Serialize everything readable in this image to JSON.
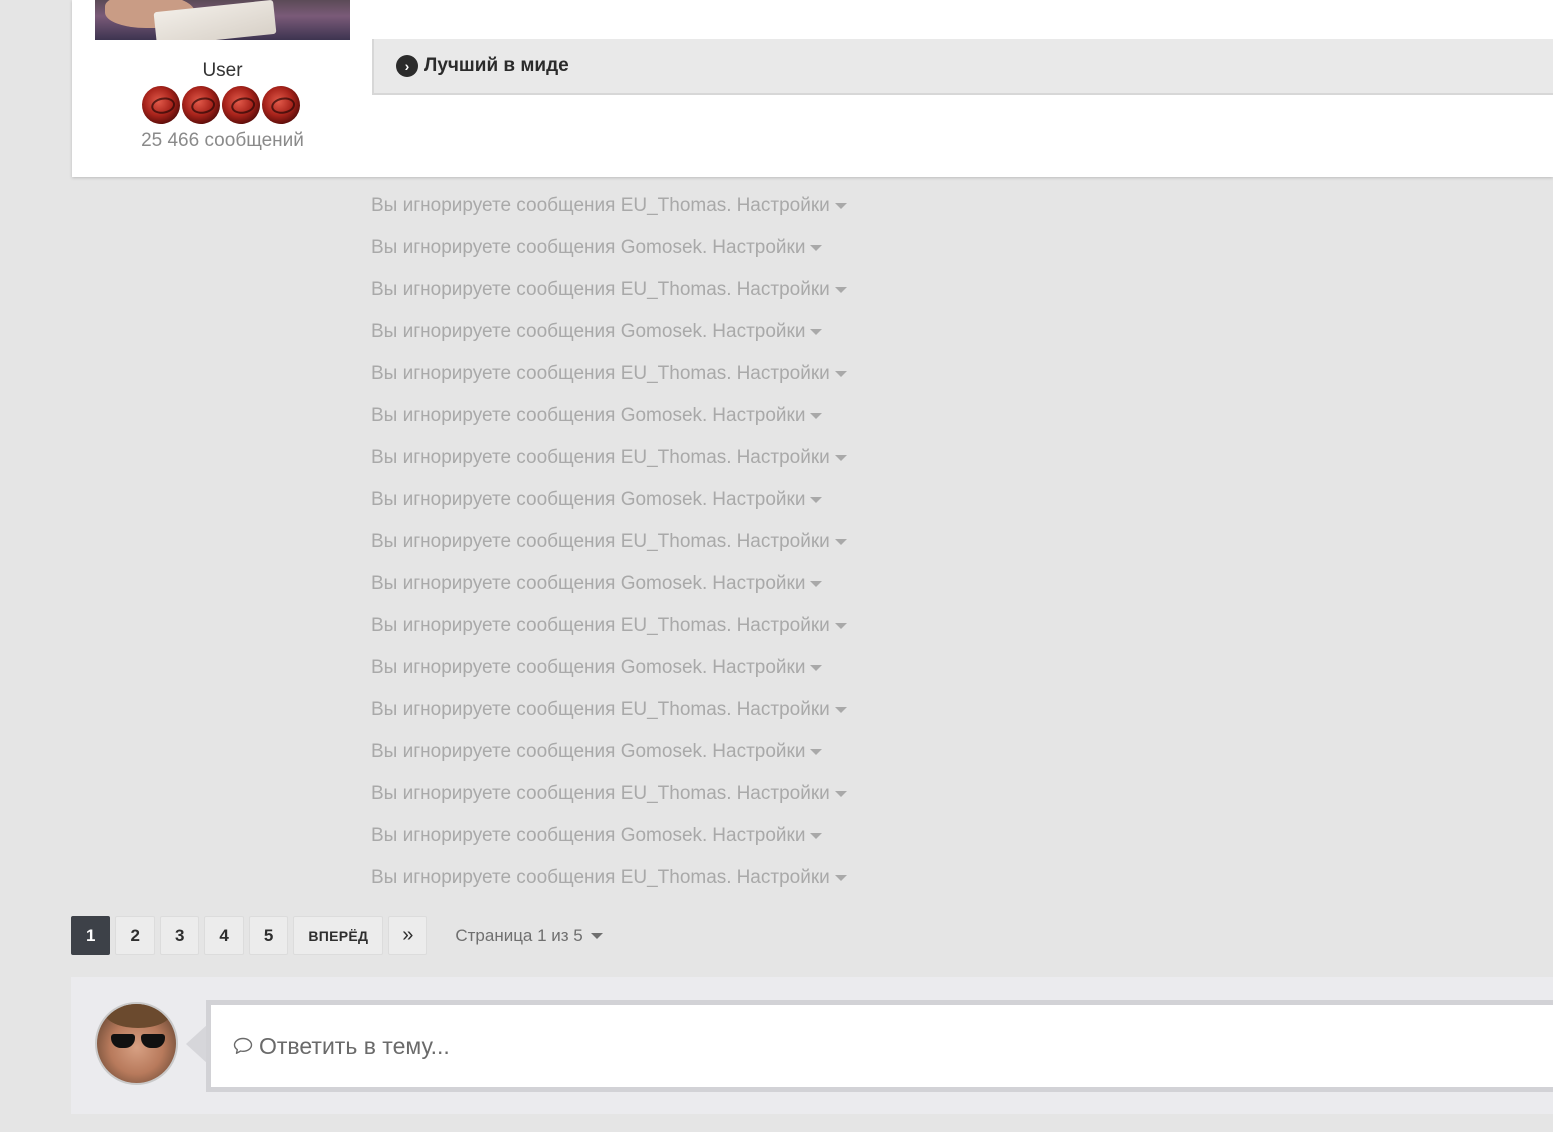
{
  "post": {
    "author_group": "User",
    "post_count": "25 466 сообщений",
    "signature_link": "Лучший в миде"
  },
  "ignored": {
    "prefix": "Вы игнорируете сообщения",
    "settings_label": "Настройки",
    "items": [
      {
        "user": "EU_Thomas."
      },
      {
        "user": "Gomosek."
      },
      {
        "user": "EU_Thomas."
      },
      {
        "user": "Gomosek."
      },
      {
        "user": "EU_Thomas."
      },
      {
        "user": "Gomosek."
      },
      {
        "user": "EU_Thomas."
      },
      {
        "user": "Gomosek."
      },
      {
        "user": "EU_Thomas."
      },
      {
        "user": "Gomosek."
      },
      {
        "user": "EU_Thomas."
      },
      {
        "user": "Gomosek."
      },
      {
        "user": "EU_Thomas."
      },
      {
        "user": "Gomosek."
      },
      {
        "user": "EU_Thomas."
      },
      {
        "user": "Gomosek."
      },
      {
        "user": "EU_Thomas."
      }
    ]
  },
  "pagination": {
    "pages": [
      "1",
      "2",
      "3",
      "4",
      "5"
    ],
    "active_page": "1",
    "next_label": "ВПЕРЁД",
    "last_label": "»",
    "status": "Страница 1 из 5"
  },
  "reply": {
    "placeholder": "Ответить в тему..."
  },
  "colors": {
    "background": "#e5e5e5",
    "active_page": "#3d4148",
    "ignored_text": "#a9a9a9"
  }
}
